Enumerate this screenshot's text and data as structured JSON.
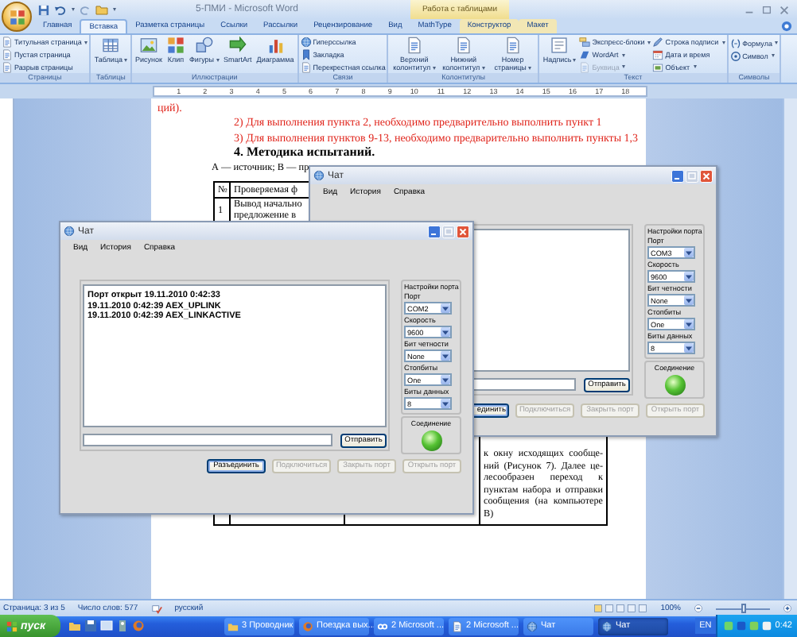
{
  "word": {
    "title": "5-ПМИ - Microsoft Word",
    "context_group": "Работа с таблицами",
    "tabs": [
      {
        "label": "Главная",
        "selected": false,
        "contextual": false
      },
      {
        "label": "Вставка",
        "selected": true,
        "contextual": false
      },
      {
        "label": "Разметка страницы",
        "selected": false,
        "contextual": false
      },
      {
        "label": "Ссылки",
        "selected": false,
        "contextual": false
      },
      {
        "label": "Рассылки",
        "selected": false,
        "contextual": false
      },
      {
        "label": "Рецензирование",
        "selected": false,
        "contextual": false
      },
      {
        "label": "Вид",
        "selected": false,
        "contextual": false
      },
      {
        "label": "MathType",
        "selected": false,
        "contextual": false
      },
      {
        "label": "Конструктор",
        "selected": false,
        "contextual": true
      },
      {
        "label": "Макет",
        "selected": false,
        "contextual": true
      }
    ],
    "ribbon_groups": [
      {
        "name": "Страницы",
        "items": [
          {
            "kind": "small",
            "label": "Титульная страница",
            "dropdown": true
          },
          {
            "kind": "small",
            "label": "Пустая страница",
            "dropdown": false
          },
          {
            "kind": "small",
            "label": "Разрыв страницы",
            "dropdown": false
          }
        ]
      },
      {
        "name": "Таблицы",
        "items": [
          {
            "kind": "large",
            "label": "Таблица",
            "dropdown": true
          }
        ]
      },
      {
        "name": "Иллюстрации",
        "items": [
          {
            "kind": "large",
            "label": "Рисунок",
            "dropdown": false
          },
          {
            "kind": "large",
            "label": "Клип",
            "dropdown": false
          },
          {
            "kind": "large",
            "label": "Фигуры",
            "dropdown": true
          },
          {
            "kind": "large",
            "label": "SmartArt",
            "dropdown": false
          },
          {
            "kind": "large",
            "label": "Диаграмма",
            "dropdown": false
          }
        ]
      },
      {
        "name": "Связи",
        "items": [
          {
            "kind": "small",
            "label": "Гиперссылка",
            "dropdown": false
          },
          {
            "kind": "small",
            "label": "Закладка",
            "dropdown": false
          },
          {
            "kind": "small",
            "label": "Перекрестная ссылка",
            "dropdown": false
          }
        ]
      },
      {
        "name": "Колонтитулы",
        "items": [
          {
            "kind": "large",
            "label": "Верхний колонтитул",
            "dropdown": true
          },
          {
            "kind": "large",
            "label": "Нижний колонтитул",
            "dropdown": true
          },
          {
            "kind": "large",
            "label": "Номер страницы",
            "dropdown": true
          }
        ]
      },
      {
        "name": "Текст",
        "items": [
          {
            "kind": "large",
            "label": "Надпись",
            "dropdown": true,
            "disabled": false
          },
          {
            "kind": "small",
            "label": "Экспресс-блоки",
            "dropdown": true,
            "disabled": false
          },
          {
            "kind": "small",
            "label": "WordArt",
            "dropdown": true,
            "disabled": false
          },
          {
            "kind": "small",
            "label": "Буквица",
            "dropdown": true,
            "disabled": true
          },
          {
            "kind": "small",
            "label": "Строка подписи",
            "dropdown": true,
            "disabled": false
          },
          {
            "kind": "small",
            "label": "Дата и время",
            "dropdown": false,
            "disabled": false
          },
          {
            "kind": "small",
            "label": "Объект",
            "dropdown": true,
            "disabled": false
          }
        ]
      },
      {
        "name": "Символы",
        "items": [
          {
            "kind": "small",
            "label": "Формула",
            "dropdown": true
          },
          {
            "kind": "small",
            "label": "Символ",
            "dropdown": true
          }
        ]
      }
    ],
    "ruler_marks": [
      "1",
      "2",
      "3",
      "4",
      "5",
      "6",
      "7",
      "8",
      "9",
      "10",
      "11",
      "12",
      "13",
      "14",
      "15",
      "16",
      "17",
      "18"
    ],
    "document": {
      "paragraphs": [
        {
          "kind": "note_continuation",
          "text": "ций)."
        },
        {
          "kind": "note",
          "text": "2) Для выполнения пункта 2, необходимо предварительно выполнить пункт 1"
        },
        {
          "kind": "note",
          "text": "3) Для выполнения пунктов 9-13, необходимо предварительно выполнить пункты 1,3"
        },
        {
          "kind": "heading",
          "text": "4. Методика испытаний."
        },
        {
          "kind": "body",
          "text": "А — источник; В — пр"
        }
      ],
      "table": {
        "header": [
          "№",
          "Проверяемая ф"
        ],
        "rows": [
          {
            "number": "1",
            "column_2": [
              "Вывод начально",
              "предложение в"
            ],
            "column_4": [
              "к окну исходящих сообще-",
              "ний (Рисунок 7). Далее це-",
              "лесообразен переход к",
              "пунктам набора и отправки",
              "сообщения (на компьютере",
              "В)"
            ]
          }
        ]
      }
    },
    "status_bar": {
      "page": "Страница: 3 из 5",
      "words": "Число слов: 577",
      "language": "русский",
      "zoom": "100%",
      "zoom_slider": {
        "level": 0.5
      }
    }
  },
  "chat_windows": [
    {
      "title": "Чат",
      "menu": [
        "Вид",
        "История",
        "Справка"
      ],
      "send_button": "Отправить",
      "settings_title": "Настройки порта",
      "settings": [
        {
          "label": "Порт",
          "value": "COM3"
        },
        {
          "label": "Скорость",
          "value": "9600"
        },
        {
          "label": "Бит четности",
          "value": "None"
        },
        {
          "label": "Стопбиты",
          "value": "One"
        },
        {
          "label": "Биты данных",
          "value": "8"
        }
      ],
      "connection_title": "Соединение",
      "connected": true,
      "buttons": [
        {
          "label": "единить",
          "disabled": false,
          "default": true
        },
        {
          "label": "Подключиться",
          "disabled": true,
          "default": false
        },
        {
          "label": "Закрыть порт",
          "disabled": true,
          "default": false
        },
        {
          "label": "Открыть порт",
          "disabled": true,
          "default": false
        }
      ]
    },
    {
      "title": "Чат",
      "menu": [
        "Вид",
        "История",
        "Справка"
      ],
      "log": [
        "Порт открыт 19.11.2010 0:42:33",
        "19.11.2010 0:42:39 AEX_UPLINK",
        "19.11.2010 0:42:39 AEX_LINKACTIVE"
      ],
      "send_button": "Отправить",
      "settings_title": "Настройки порта",
      "settings": [
        {
          "label": "Порт",
          "value": "COM2"
        },
        {
          "label": "Скорость",
          "value": "9600"
        },
        {
          "label": "Бит четности",
          "value": "None"
        },
        {
          "label": "Стопбиты",
          "value": "One"
        },
        {
          "label": "Биты данных",
          "value": "8"
        }
      ],
      "connection_title": "Соединение",
      "connected": true,
      "buttons": [
        {
          "label": "Разъединить",
          "disabled": false,
          "default": true
        },
        {
          "label": "Подключиться",
          "disabled": true,
          "default": false
        },
        {
          "label": "Закрыть порт",
          "disabled": true,
          "default": false
        },
        {
          "label": "Открыть порт",
          "disabled": true,
          "default": false
        }
      ]
    }
  ],
  "taskbar": {
    "start": "пуск",
    "tasks": [
      {
        "label": "3 Проводник",
        "selected": false
      },
      {
        "label": "Поездка вых...",
        "selected": false
      },
      {
        "label": "2 Microsoft ...",
        "selected": false
      },
      {
        "label": "2 Microsoft ...",
        "selected": false
      },
      {
        "label": "Чат",
        "selected": false
      },
      {
        "label": "Чат",
        "selected": true
      }
    ],
    "language": "EN",
    "clock": "0:42"
  }
}
